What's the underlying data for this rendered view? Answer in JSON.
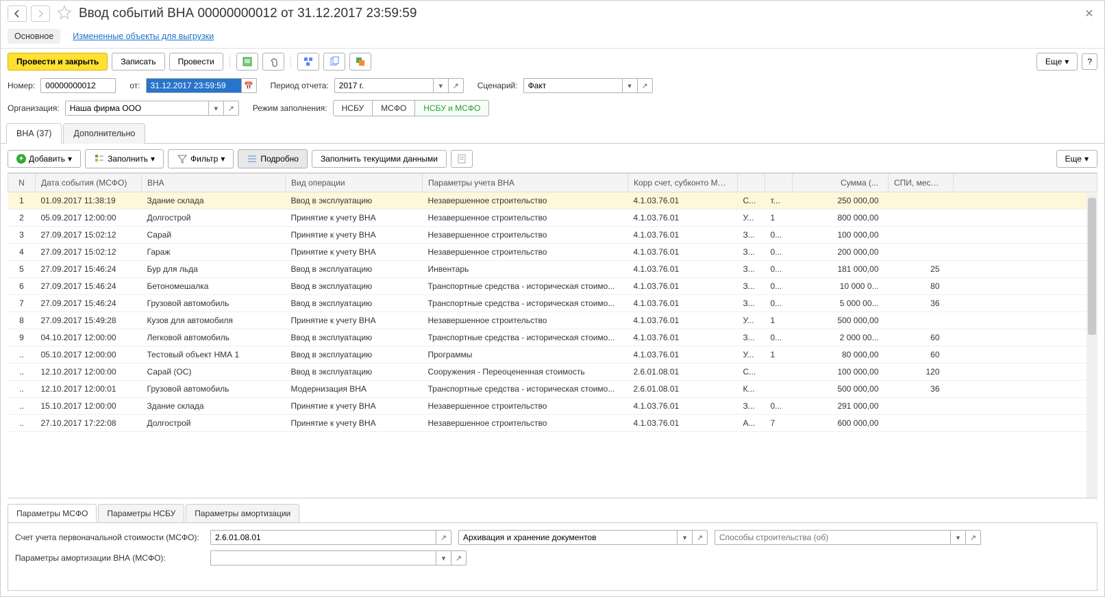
{
  "title": "Ввод событий ВНА 00000000012 от 31.12.2017 23:59:59",
  "subnav": {
    "main": "Основное",
    "changed": "Измененные объекты для выгрузки"
  },
  "toolbar": {
    "post_close": "Провести и закрыть",
    "write": "Записать",
    "post": "Провести",
    "more": "Еще"
  },
  "fields": {
    "number_label": "Номер:",
    "number": "00000000012",
    "from_label": "от:",
    "from": "31.12.2017 23:59:59",
    "period_label": "Период отчета:",
    "period": "2017 г.",
    "scenario_label": "Сценарий:",
    "scenario": "Факт",
    "org_label": "Организация:",
    "org": "Наша фирма ООО",
    "fill_mode_label": "Режим заполнения:",
    "mode_nsbu": "НСБУ",
    "mode_msfo": "МСФО",
    "mode_both": "НСБУ и МСФО"
  },
  "tabs": {
    "vna": "ВНА (37)",
    "extra": "Дополнительно"
  },
  "tblbar": {
    "add": "Добавить",
    "fill": "Заполнить",
    "filter": "Фильтр",
    "details": "Подробно",
    "fill_current": "Заполнить текущими данными",
    "more": "Еще"
  },
  "cols": {
    "n": "N",
    "date": "Дата события (МСФО)",
    "vna": "ВНА",
    "op": "Вид операции",
    "par": "Параметры учета ВНА",
    "acc": "Корр счет, субконто МСФО",
    "sum": "Сумма (...",
    "spi": "СПИ, мес...."
  },
  "rows": [
    {
      "n": "1",
      "date": "01.09.2017 11:38:19",
      "vna": "Здание склада",
      "op": "Ввод в эксплуатацию",
      "par": "Незавершенное строительство",
      "acc": "4.1.03.76.01",
      "s1": "С...",
      "s2": "т...",
      "sum": "250 000,00",
      "spi": ""
    },
    {
      "n": "2",
      "date": "05.09.2017 12:00:00",
      "vna": "Долгострой",
      "op": "Принятие к учету ВНА",
      "par": "Незавершенное строительство",
      "acc": "4.1.03.76.01",
      "s1": "У...",
      "s2": "1",
      "sum": "800 000,00",
      "spi": ""
    },
    {
      "n": "3",
      "date": "27.09.2017 15:02:12",
      "vna": "Сарай",
      "op": "Принятие к учету ВНА",
      "par": "Незавершенное строительство",
      "acc": "4.1.03.76.01",
      "s1": "З...",
      "s2": "0...",
      "sum": "100 000,00",
      "spi": ""
    },
    {
      "n": "4",
      "date": "27.09.2017 15:02:12",
      "vna": "Гараж",
      "op": "Принятие к учету ВНА",
      "par": "Незавершенное строительство",
      "acc": "4.1.03.76.01",
      "s1": "З...",
      "s2": "0...",
      "sum": "200 000,00",
      "spi": ""
    },
    {
      "n": "5",
      "date": "27.09.2017 15:46:24",
      "vna": "Бур для льда",
      "op": "Ввод в эксплуатацию",
      "par": "Инвентарь",
      "acc": "4.1.03.76.01",
      "s1": "З...",
      "s2": "0...",
      "sum": "181 000,00",
      "spi": "25"
    },
    {
      "n": "6",
      "date": "27.09.2017 15:46:24",
      "vna": "Бетономешалка",
      "op": "Ввод в эксплуатацию",
      "par": "Транспортные средства - историческая стоимо...",
      "acc": "4.1.03.76.01",
      "s1": "З...",
      "s2": "0...",
      "sum": "10 000 0...",
      "spi": "80"
    },
    {
      "n": "7",
      "date": "27.09.2017 15:46:24",
      "vna": "Грузовой автомобиль",
      "op": "Ввод в эксплуатацию",
      "par": "Транспортные средства - историческая стоимо...",
      "acc": "4.1.03.76.01",
      "s1": "З...",
      "s2": "0...",
      "sum": "5 000 00...",
      "spi": "36"
    },
    {
      "n": "8",
      "date": "27.09.2017 15:49:28",
      "vna": "Кузов для автомобиля",
      "op": "Принятие к учету ВНА",
      "par": "Незавершенное строительство",
      "acc": "4.1.03.76.01",
      "s1": "У...",
      "s2": "1",
      "sum": "500 000,00",
      "spi": ""
    },
    {
      "n": "9",
      "date": "04.10.2017 12:00:00",
      "vna": "Легковой автомобиль",
      "op": "Ввод в эксплуатацию",
      "par": "Транспортные средства - историческая стоимо...",
      "acc": "4.1.03.76.01",
      "s1": "З...",
      "s2": "0...",
      "sum": "2 000 00...",
      "spi": "60"
    },
    {
      "n": "..",
      "date": "05.10.2017 12:00:00",
      "vna": "Тестовый объект НМА 1",
      "op": "Ввод в эксплуатацию",
      "par": "Программы",
      "acc": "4.1.03.76.01",
      "s1": "У...",
      "s2": "1",
      "sum": "80 000,00",
      "spi": "60"
    },
    {
      "n": "..",
      "date": "12.10.2017 12:00:00",
      "vna": "Сарай (ОС)",
      "op": "Ввод в эксплуатацию",
      "par": "Сооружения - Переоцененная стоимость",
      "acc": "2.6.01.08.01",
      "s1": "С...",
      "s2": "",
      "sum": "100 000,00",
      "spi": "120"
    },
    {
      "n": "..",
      "date": "12.10.2017 12:00:01",
      "vna": "Грузовой автомобиль",
      "op": "Модернизация ВНА",
      "par": "Транспортные средства - историческая стоимо...",
      "acc": "2.6.01.08.01",
      "s1": "К...",
      "s2": "",
      "sum": "500 000,00",
      "spi": "36"
    },
    {
      "n": "..",
      "date": "15.10.2017 12:00:00",
      "vna": "Здание склада",
      "op": "Принятие к учету ВНА",
      "par": "Незавершенное строительство",
      "acc": "4.1.03.76.01",
      "s1": "З...",
      "s2": "0...",
      "sum": "291 000,00",
      "spi": ""
    },
    {
      "n": "..",
      "date": "27.10.2017 17:22:08",
      "vna": "Долгострой",
      "op": "Принятие к учету ВНА",
      "par": "Незавершенное строительство",
      "acc": "4.1.03.76.01",
      "s1": "А...",
      "s2": "7",
      "sum": "600 000,00",
      "spi": ""
    }
  ],
  "bottom_tabs": {
    "msfo": "Параметры МСФО",
    "nsbu": "Параметры НСБУ",
    "amort": "Параметры амортизации"
  },
  "bottom": {
    "acc_label": "Счет учета первоначальной стоимости (МСФО):",
    "acc": "2.6.01.08.01",
    "field2": "Архивация и хранение документов",
    "field3_ph": "Способы строительства (об)",
    "amort_label": "Параметры амортизации ВНА (МСФО):"
  }
}
